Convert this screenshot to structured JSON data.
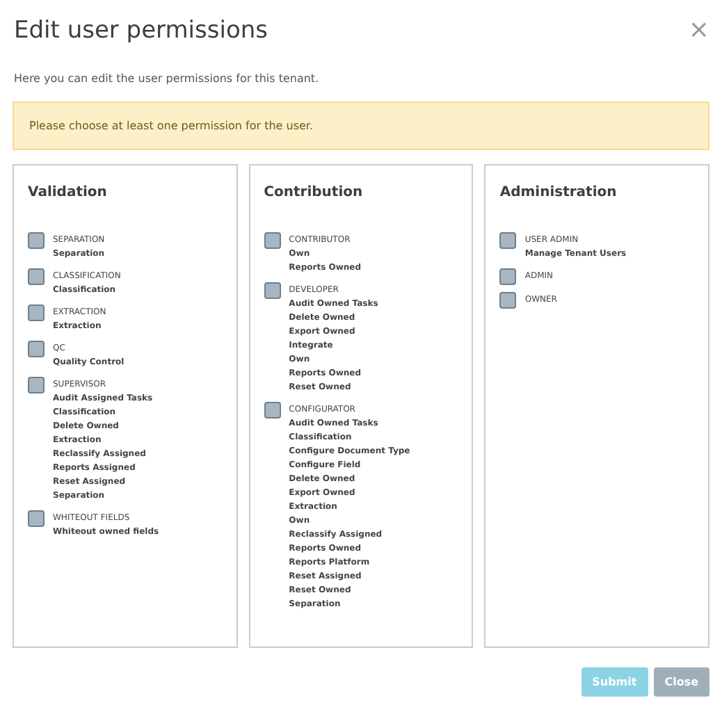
{
  "dialog": {
    "title": "Edit user permissions",
    "close_icon": "×",
    "description": "Here you can edit the user permissions for this tenant.",
    "alert": "Please choose at least one permission for the user."
  },
  "groups": [
    {
      "title": "Validation",
      "roles": [
        {
          "name": "SEPARATION",
          "checked": false,
          "permissions": [
            "Separation"
          ]
        },
        {
          "name": "CLASSIFICATION",
          "checked": false,
          "permissions": [
            "Classification"
          ]
        },
        {
          "name": "EXTRACTION",
          "checked": false,
          "permissions": [
            "Extraction"
          ]
        },
        {
          "name": "QC",
          "checked": false,
          "permissions": [
            "Quality Control"
          ]
        },
        {
          "name": "SUPERVISOR",
          "checked": false,
          "permissions": [
            "Audit Assigned Tasks",
            "Classification",
            "Delete Owned",
            "Extraction",
            "Reclassify Assigned",
            "Reports Assigned",
            "Reset Assigned",
            "Separation"
          ]
        },
        {
          "name": "WHITEOUT FIELDS",
          "checked": false,
          "permissions": [
            "Whiteout owned fields"
          ]
        }
      ]
    },
    {
      "title": "Contribution",
      "roles": [
        {
          "name": "CONTRIBUTOR",
          "checked": false,
          "permissions": [
            "Own",
            "Reports Owned"
          ]
        },
        {
          "name": "DEVELOPER",
          "checked": false,
          "permissions": [
            "Audit Owned Tasks",
            "Delete Owned",
            "Export Owned",
            "Integrate",
            "Own",
            "Reports Owned",
            "Reset Owned"
          ]
        },
        {
          "name": "CONFIGURATOR",
          "checked": false,
          "permissions": [
            "Audit Owned Tasks",
            "Classification",
            "Configure Document Type",
            "Configure Field",
            "Delete Owned",
            "Export Owned",
            "Extraction",
            "Own",
            "Reclassify Assigned",
            "Reports Owned",
            "Reports Platform",
            "Reset Assigned",
            "Reset Owned",
            "Separation"
          ]
        }
      ]
    },
    {
      "title": "Administration",
      "roles": [
        {
          "name": "USER ADMIN",
          "checked": false,
          "permissions": [
            "Manage Tenant Users"
          ]
        },
        {
          "name": "ADMIN",
          "checked": false
        },
        {
          "name": "OWNER",
          "checked": false
        }
      ]
    }
  ],
  "buttons": [
    {
      "label": "Submit",
      "kind": "primary",
      "disabled": true
    },
    {
      "label": "Close",
      "kind": "secondary",
      "disabled": false
    }
  ]
}
